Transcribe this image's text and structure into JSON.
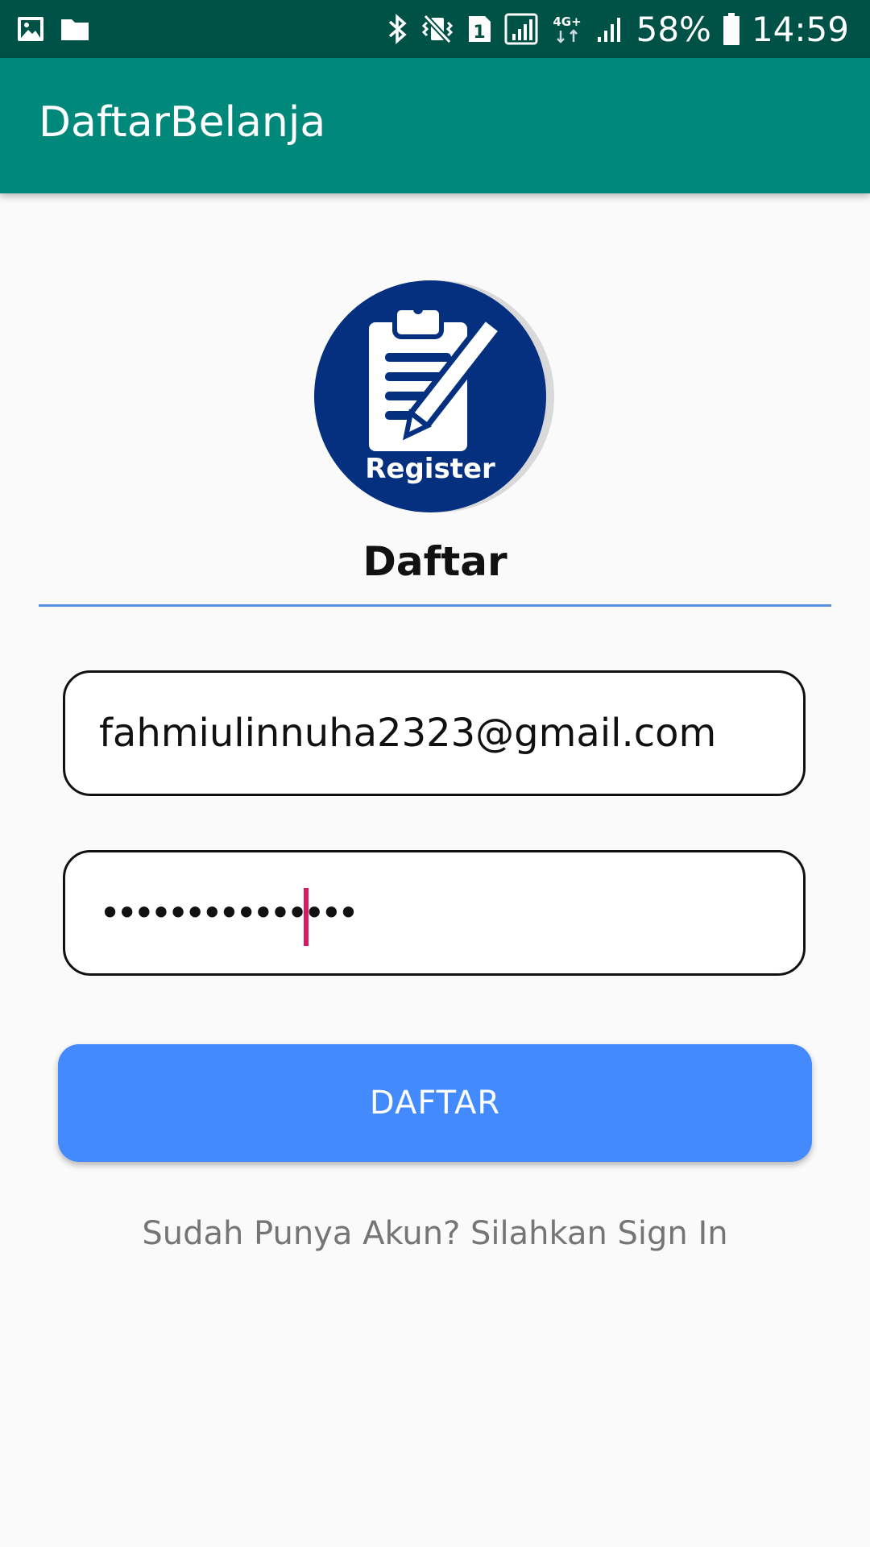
{
  "status_bar": {
    "battery_percent": "58%",
    "time": "14:59",
    "network_label": "4G+",
    "sim_slot": "1",
    "icons": [
      "image-icon",
      "folder-icon",
      "bluetooth-icon",
      "vibrate-icon",
      "sim-icon",
      "signal-icon",
      "network-4g-icon",
      "signal-icon",
      "battery-icon"
    ]
  },
  "app_bar": {
    "title": "DaftarBelanja"
  },
  "logo": {
    "label": "Register",
    "icon": "clipboard-pen-icon",
    "background_color": "#04307f"
  },
  "form": {
    "heading": "Daftar",
    "email_value": "fahmiulinnuha2323@gmail.com",
    "password_mask": "•••••••••••••••",
    "submit_label": "DAFTAR",
    "signin_text": "Sudah Punya Akun? Silahkan Sign In"
  },
  "colors": {
    "status_bar": "#005146",
    "app_bar": "#00897b",
    "button": "#448aff",
    "divider": "#5b8fe0",
    "cursor": "#d81b60"
  }
}
